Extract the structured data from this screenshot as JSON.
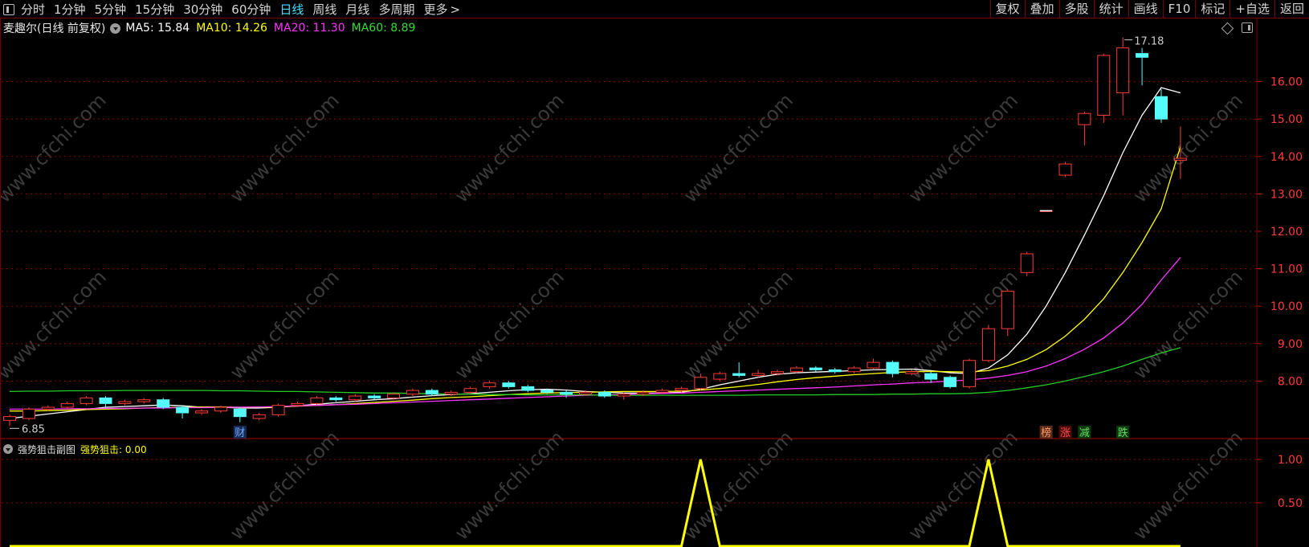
{
  "toolbar": {
    "timeframes": [
      "分时",
      "1分钟",
      "5分钟",
      "15分钟",
      "30分钟",
      "60分钟",
      "日线",
      "周线",
      "月线",
      "多周期",
      "更多"
    ],
    "active": "日线",
    "right_buttons": [
      "复权",
      "叠加",
      "多股",
      "统计",
      "画线",
      "F10",
      "标记",
      "+自选",
      "返回"
    ]
  },
  "stock": {
    "name": "麦趣尔",
    "mode": "(日线 前复权)",
    "ma": [
      {
        "label": "MA5: 15.84",
        "color": "#ffffff"
      },
      {
        "label": "MA10: 14.26",
        "color": "#ffff00"
      },
      {
        "label": "MA20: 11.30",
        "color": "#ff33ff"
      },
      {
        "label": "MA60: 8.89",
        "color": "#33dd33"
      }
    ]
  },
  "price_axis": {
    "labels": [
      "16.00",
      "15.00",
      "14.00",
      "13.00",
      "12.00",
      "11.00",
      "10.00",
      "9.00",
      "8.00"
    ]
  },
  "annotations": {
    "high": "17.18",
    "low": "6.85",
    "cai": "财",
    "bang": "榜",
    "zhang": "涨",
    "jian": "减",
    "die": "跌"
  },
  "indicator": {
    "name": "强势狙击副图",
    "value_label": "强势狙击: 0.00",
    "axis_labels": [
      "1.00",
      "0.50"
    ]
  },
  "watermark": "www.cfchi.com",
  "colors": {
    "up": "#ff3a3a",
    "down": "#54fcfc",
    "grid": "#7a0000",
    "accent": "#44e0ff"
  },
  "chart_data": [
    {
      "type": "candlestick",
      "title": "麦趣尔(日线 前复权)",
      "ylim": [
        6.3,
        17.5
      ],
      "candles": [
        [
          6.95,
          7.05,
          6.8,
          7.1
        ],
        [
          7.0,
          7.25,
          6.95,
          7.3
        ],
        [
          7.25,
          7.3,
          7.2,
          7.35
        ],
        [
          7.3,
          7.4,
          7.25,
          7.45
        ],
        [
          7.4,
          7.55,
          7.35,
          7.6
        ],
        [
          7.55,
          7.4,
          7.3,
          7.6
        ],
        [
          7.4,
          7.45,
          7.35,
          7.5
        ],
        [
          7.45,
          7.5,
          7.4,
          7.55
        ],
        [
          7.5,
          7.3,
          7.25,
          7.55
        ],
        [
          7.3,
          7.15,
          7.0,
          7.35
        ],
        [
          7.15,
          7.2,
          7.1,
          7.25
        ],
        [
          7.2,
          7.3,
          7.15,
          7.35
        ],
        [
          7.25,
          7.05,
          6.9,
          7.3
        ],
        [
          7.0,
          7.1,
          6.95,
          7.15
        ],
        [
          7.1,
          7.35,
          7.05,
          7.4
        ],
        [
          7.35,
          7.4,
          7.3,
          7.45
        ],
        [
          7.4,
          7.55,
          7.35,
          7.6
        ],
        [
          7.55,
          7.5,
          7.45,
          7.6
        ],
        [
          7.5,
          7.6,
          7.45,
          7.65
        ],
        [
          7.6,
          7.55,
          7.5,
          7.65
        ],
        [
          7.55,
          7.65,
          7.5,
          7.7
        ],
        [
          7.65,
          7.75,
          7.6,
          7.8
        ],
        [
          7.75,
          7.65,
          7.6,
          7.8
        ],
        [
          7.65,
          7.7,
          7.6,
          7.75
        ],
        [
          7.7,
          7.8,
          7.65,
          7.85
        ],
        [
          7.85,
          7.95,
          7.8,
          8.0
        ],
        [
          7.95,
          7.85,
          7.8,
          8.0
        ],
        [
          7.85,
          7.75,
          7.7,
          7.9
        ],
        [
          7.75,
          7.7,
          7.65,
          7.8
        ],
        [
          7.7,
          7.65,
          7.55,
          7.75
        ],
        [
          7.65,
          7.7,
          7.6,
          7.75
        ],
        [
          7.7,
          7.6,
          7.55,
          7.75
        ],
        [
          7.6,
          7.65,
          7.5,
          7.7
        ],
        [
          7.65,
          7.7,
          7.6,
          7.75
        ],
        [
          7.7,
          7.75,
          7.65,
          7.8
        ],
        [
          7.75,
          7.8,
          7.7,
          7.85
        ],
        [
          7.8,
          8.1,
          7.75,
          8.2
        ],
        [
          8.05,
          8.2,
          8.0,
          8.25
        ],
        [
          8.2,
          8.15,
          8.1,
          8.5
        ],
        [
          8.15,
          8.2,
          8.1,
          8.3
        ],
        [
          8.2,
          8.25,
          8.15,
          8.3
        ],
        [
          8.25,
          8.35,
          8.2,
          8.4
        ],
        [
          8.35,
          8.3,
          8.25,
          8.4
        ],
        [
          8.3,
          8.25,
          8.2,
          8.35
        ],
        [
          8.25,
          8.35,
          8.2,
          8.4
        ],
        [
          8.35,
          8.5,
          8.3,
          8.6
        ],
        [
          8.5,
          8.2,
          8.1,
          8.55
        ],
        [
          8.2,
          8.25,
          8.15,
          8.3
        ],
        [
          8.2,
          8.05,
          7.95,
          8.25
        ],
        [
          8.1,
          7.85,
          7.8,
          8.15
        ],
        [
          7.85,
          8.55,
          7.8,
          8.6
        ],
        [
          8.55,
          9.4,
          8.5,
          9.5
        ],
        [
          9.4,
          10.4,
          9.2,
          10.45
        ],
        [
          10.9,
          11.4,
          10.8,
          11.45
        ],
        [
          12.55,
          12.55,
          12.55,
          12.55
        ],
        [
          13.5,
          13.8,
          13.45,
          13.85
        ],
        [
          14.85,
          15.15,
          14.3,
          15.2
        ],
        [
          15.1,
          16.7,
          14.9,
          16.75
        ],
        [
          15.7,
          16.9,
          15.1,
          17.18
        ],
        [
          16.75,
          16.65,
          15.9,
          16.9
        ],
        [
          15.6,
          15.0,
          14.9,
          15.8
        ],
        [
          13.9,
          13.95,
          13.4,
          14.8
        ]
      ],
      "series": [
        {
          "name": "MA5",
          "values": [
            7.0,
            7.06,
            7.12,
            7.18,
            7.24,
            7.3,
            7.32,
            7.34,
            7.36,
            7.34,
            7.3,
            7.3,
            7.28,
            7.28,
            7.3,
            7.34,
            7.38,
            7.42,
            7.46,
            7.5,
            7.53,
            7.57,
            7.61,
            7.64,
            7.66,
            7.7,
            7.74,
            7.77,
            7.78,
            7.76,
            7.72,
            7.7,
            7.68,
            7.68,
            7.68,
            7.7,
            7.78,
            7.9,
            8.0,
            8.1,
            8.18,
            8.22,
            8.24,
            8.26,
            8.28,
            8.3,
            8.31,
            8.32,
            8.28,
            8.22,
            8.2,
            8.35,
            8.7,
            9.25,
            10.0,
            10.9,
            11.9,
            12.95,
            14.1,
            15.1,
            15.84,
            15.7
          ]
        },
        {
          "name": "MA10",
          "values": [
            7.2,
            7.2,
            7.21,
            7.22,
            7.24,
            7.25,
            7.26,
            7.28,
            7.29,
            7.3,
            7.31,
            7.31,
            7.3,
            7.3,
            7.31,
            7.33,
            7.35,
            7.37,
            7.4,
            7.43,
            7.46,
            7.49,
            7.53,
            7.56,
            7.58,
            7.61,
            7.64,
            7.66,
            7.68,
            7.69,
            7.7,
            7.71,
            7.72,
            7.72,
            7.72,
            7.73,
            7.76,
            7.8,
            7.85,
            7.91,
            7.98,
            8.04,
            8.09,
            8.13,
            8.17,
            8.2,
            8.23,
            8.25,
            8.26,
            8.25,
            8.24,
            8.28,
            8.4,
            8.58,
            8.84,
            9.2,
            9.65,
            10.2,
            10.9,
            11.7,
            12.6,
            14.26
          ]
        },
        {
          "name": "MA20",
          "values": [
            7.25,
            7.25,
            7.25,
            7.26,
            7.26,
            7.27,
            7.27,
            7.28,
            7.28,
            7.29,
            7.29,
            7.3,
            7.3,
            7.31,
            7.32,
            7.34,
            7.35,
            7.37,
            7.38,
            7.4,
            7.42,
            7.44,
            7.46,
            7.48,
            7.5,
            7.52,
            7.54,
            7.56,
            7.58,
            7.6,
            7.62,
            7.63,
            7.64,
            7.66,
            7.67,
            7.68,
            7.7,
            7.72,
            7.74,
            7.76,
            7.78,
            7.8,
            7.82,
            7.84,
            7.87,
            7.9,
            7.92,
            7.95,
            7.97,
            8.0,
            8.03,
            8.08,
            8.15,
            8.25,
            8.4,
            8.6,
            8.85,
            9.15,
            9.55,
            10.05,
            10.7,
            11.3
          ]
        },
        {
          "name": "MA60",
          "values": [
            7.72,
            7.73,
            7.73,
            7.74,
            7.74,
            7.74,
            7.75,
            7.75,
            7.75,
            7.75,
            7.75,
            7.74,
            7.74,
            7.73,
            7.72,
            7.72,
            7.71,
            7.7,
            7.69,
            7.68,
            7.68,
            7.67,
            7.66,
            7.65,
            7.65,
            7.64,
            7.64,
            7.63,
            7.63,
            7.63,
            7.63,
            7.62,
            7.62,
            7.62,
            7.62,
            7.62,
            7.62,
            7.62,
            7.62,
            7.63,
            7.63,
            7.63,
            7.63,
            7.64,
            7.64,
            7.64,
            7.65,
            7.65,
            7.66,
            7.66,
            7.67,
            7.7,
            7.75,
            7.82,
            7.9,
            8.0,
            8.12,
            8.25,
            8.4,
            8.58,
            8.75,
            8.89
          ]
        }
      ]
    },
    {
      "type": "line",
      "title": "强势狙击副图",
      "ylim": [
        0,
        1.15
      ],
      "series": [
        {
          "name": "强势狙击",
          "values": [
            0,
            0,
            0,
            0,
            0,
            0,
            0,
            0,
            0,
            0,
            0,
            0,
            0,
            0,
            0,
            0,
            0,
            0,
            0,
            0,
            0,
            0,
            0,
            0,
            0,
            0,
            0,
            0,
            0,
            0,
            0,
            0,
            0,
            0,
            0,
            0,
            1,
            0,
            0,
            0,
            0,
            0,
            0,
            0,
            0,
            0,
            0,
            0,
            0,
            0,
            0,
            1,
            0,
            0,
            0,
            0,
            0,
            0,
            0,
            0,
            0,
            0
          ]
        }
      ]
    }
  ]
}
